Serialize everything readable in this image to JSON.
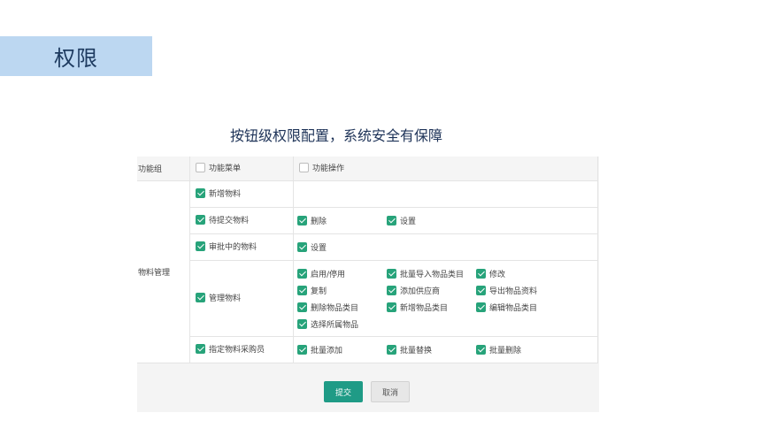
{
  "header": {
    "title": "权限"
  },
  "subtitle": "按钮级权限配置，系统安全有保障",
  "table": {
    "col_group": "功能组",
    "col_menu": "功能菜单",
    "col_ops": "功能操作",
    "group_name": "物料管理",
    "rows": [
      {
        "menu": "新增物料",
        "ops": []
      },
      {
        "menu": "待提交物料",
        "ops": [
          "删除",
          "设置"
        ]
      },
      {
        "menu": "审批中的物料",
        "ops": [
          "设置"
        ]
      },
      {
        "menu": "管理物料",
        "ops": [
          "启用/停用",
          "批量导入物品类目",
          "修改",
          "复制",
          "添加供应商",
          "导出物品资料",
          "删除物品类目",
          "新增物品类目",
          "编辑物品类目",
          "选择所属物品"
        ]
      },
      {
        "menu": "指定物料采购员",
        "ops": [
          "批量添加",
          "批量替换",
          "批量删除"
        ]
      }
    ]
  },
  "buttons": {
    "submit": "提交",
    "cancel": "取消"
  },
  "colors": {
    "accent": "#27a37a",
    "banner": "#bcd7f1",
    "submit": "#1f9b86"
  }
}
